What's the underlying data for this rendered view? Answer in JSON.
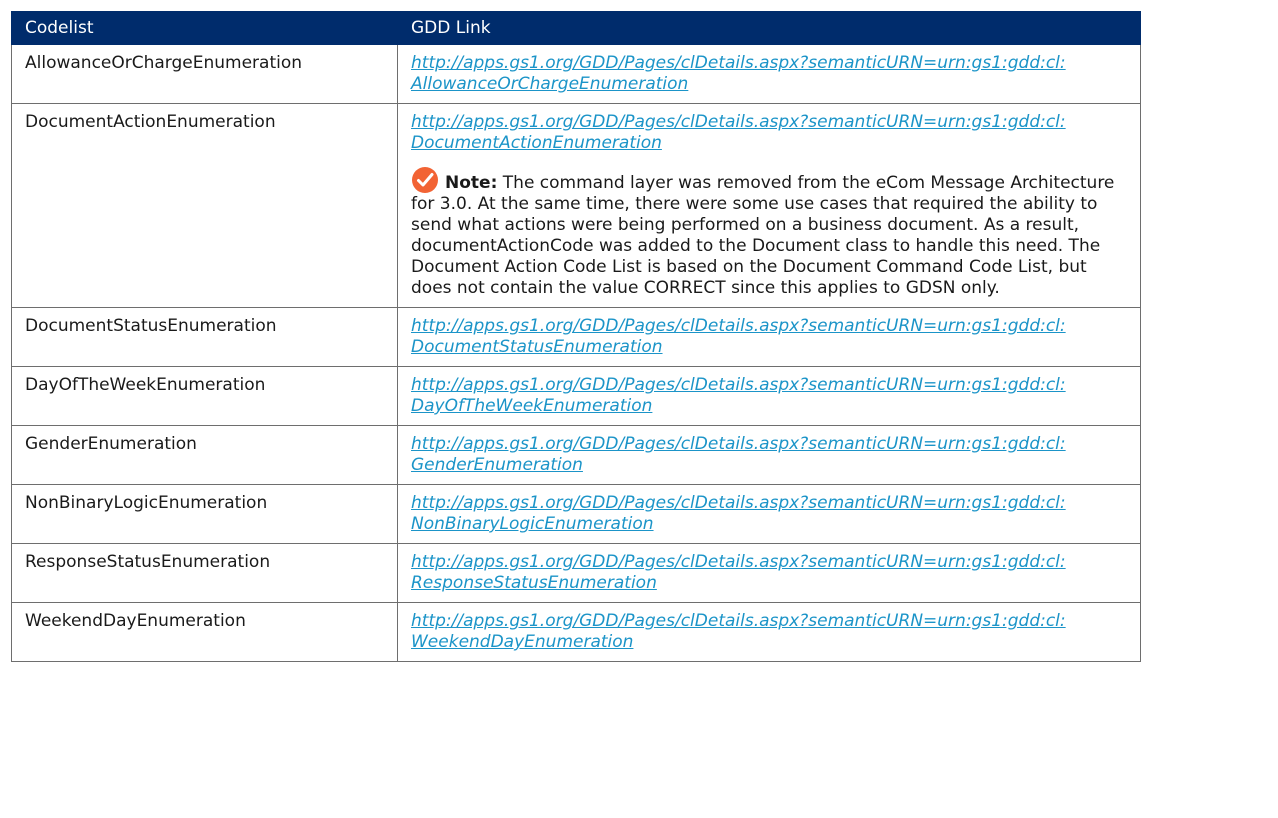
{
  "table": {
    "headers": [
      "Codelist",
      "GDD Link"
    ],
    "rows": [
      {
        "codelist": "AllowanceOrChargeEnumeration",
        "link_line1": "http://apps.gs1.org/GDD/Pages/clDetails.aspx?semanticURN=urn:gs1:gdd:cl:",
        "link_line2": "AllowanceOrChargeEnumeration"
      },
      {
        "codelist": "DocumentActionEnumeration",
        "link_line1": "http://apps.gs1.org/GDD/Pages/clDetails.aspx?semanticURN=urn:gs1:gdd:cl:",
        "link_line2": "DocumentActionEnumeration",
        "note": {
          "icon": "checkmark-circle-icon",
          "label": "Note:",
          "text": "The command layer was removed from the eCom Message Architecture for 3.0. At the same time, there were some use cases that required the ability to send what actions were being performed on a business document. As a result, documentActionCode was added to the Document class to handle this need. The Document Action Code List is based on the Document Command Code List, but does not contain the value CORRECT since this applies to GDSN only."
        }
      },
      {
        "codelist": "DocumentStatusEnumeration",
        "link_line1": "http://apps.gs1.org/GDD/Pages/clDetails.aspx?semanticURN=urn:gs1:gdd:cl:",
        "link_line2": "DocumentStatusEnumeration"
      },
      {
        "codelist": "DayOfTheWeekEnumeration",
        "link_line1": "http://apps.gs1.org/GDD/Pages/clDetails.aspx?semanticURN=urn:gs1:gdd:cl:",
        "link_line2": "DayOfTheWeekEnumeration"
      },
      {
        "codelist": "GenderEnumeration",
        "link_line1": "http://apps.gs1.org/GDD/Pages/clDetails.aspx?semanticURN=urn:gs1:gdd:cl:",
        "link_line2": "GenderEnumeration"
      },
      {
        "codelist": "NonBinaryLogicEnumeration",
        "link_line1": "http://apps.gs1.org/GDD/Pages/clDetails.aspx?semanticURN=urn:gs1:gdd:cl:",
        "link_line2": "NonBinaryLogicEnumeration"
      },
      {
        "codelist": "ResponseStatusEnumeration",
        "link_line1": "http://apps.gs1.org/GDD/Pages/clDetails.aspx?semanticURN=urn:gs1:gdd:cl:",
        "link_line2": "ResponseStatusEnumeration"
      },
      {
        "codelist": "WeekendDayEnumeration",
        "link_line1": "http://apps.gs1.org/GDD/Pages/clDetails.aspx?semanticURN=urn:gs1:gdd:cl:",
        "link_line2": "WeekendDayEnumeration"
      }
    ]
  },
  "colors": {
    "header_bg": "#002c6c",
    "link": "#1b94c8",
    "note_icon": "#f26334"
  }
}
